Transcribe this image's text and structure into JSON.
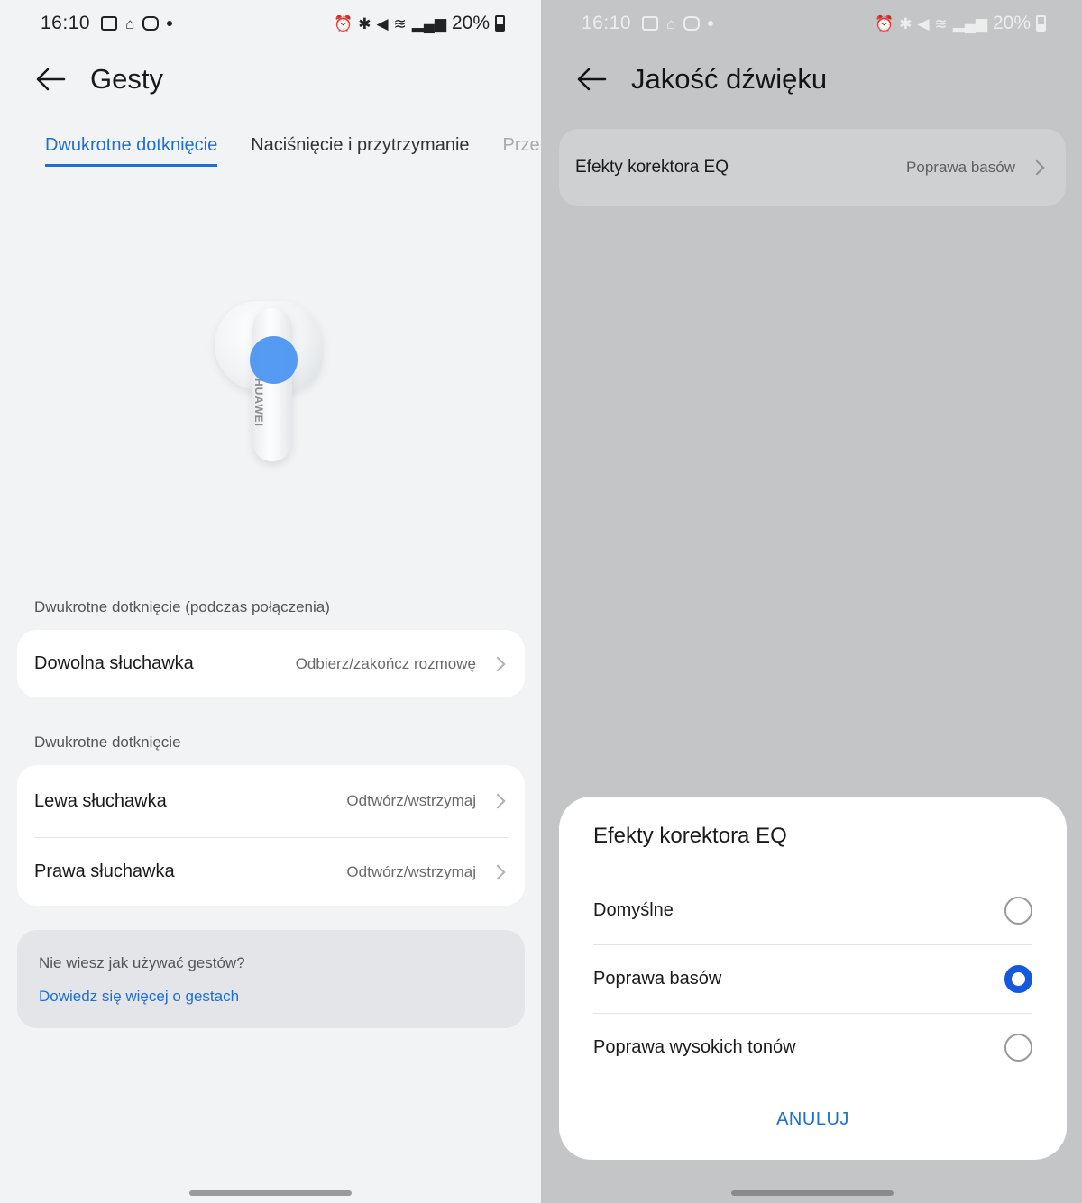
{
  "left": {
    "status": {
      "time": "16:10",
      "battery": "20%"
    },
    "header": {
      "title": "Gesty"
    },
    "tabs": [
      {
        "label": "Dwukrotne dotknięcie",
        "active": true
      },
      {
        "label": "Naciśnięcie i przytrzymanie",
        "active": false
      },
      {
        "label": "Prze",
        "active": false
      }
    ],
    "earbud_brand": "HUAWEI",
    "section_call": {
      "label": "Dwukrotne dotknięcie (podczas połączenia)",
      "rows": [
        {
          "label": "Dowolna słuchawka",
          "value": "Odbierz/zakończ rozmowę"
        }
      ]
    },
    "section_double": {
      "label": "Dwukrotne dotknięcie",
      "rows": [
        {
          "label": "Lewa słuchawka",
          "value": "Odtwórz/wstrzymaj"
        },
        {
          "label": "Prawa słuchawka",
          "value": "Odtwórz/wstrzymaj"
        }
      ]
    },
    "help": {
      "question": "Nie wiesz jak używać gestów?",
      "link": "Dowiedz się więcej o gestach"
    }
  },
  "right": {
    "status": {
      "time": "16:10",
      "battery": "20%"
    },
    "header": {
      "title": "Jakość dźwięku"
    },
    "eq_row": {
      "label": "Efekty korektora EQ",
      "value": "Poprawa basów"
    },
    "dialog": {
      "title": "Efekty korektora EQ",
      "options": [
        {
          "label": "Domyślne",
          "selected": false
        },
        {
          "label": "Poprawa basów",
          "selected": true
        },
        {
          "label": "Poprawa wysokich tonów",
          "selected": false
        }
      ],
      "cancel": "ANULUJ"
    }
  },
  "colors": {
    "accent": "#1f6fd1",
    "radio_selected": "#1458e0",
    "touch_point": "#4c95f2",
    "overlay": "#c4c5c7"
  }
}
